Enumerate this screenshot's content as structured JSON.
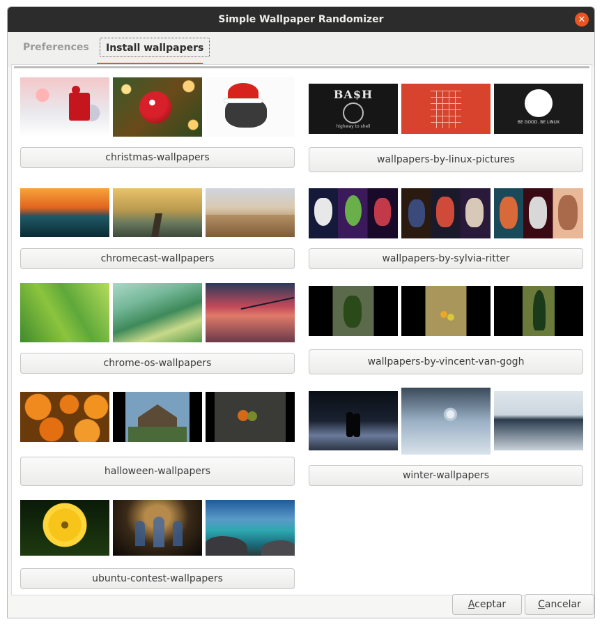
{
  "window": {
    "title": "Simple Wallpaper Randomizer"
  },
  "tabs": [
    {
      "label": "Preferences"
    },
    {
      "label": "Install wallpapers"
    }
  ],
  "packs": [
    {
      "label": "christmas-wallpapers"
    },
    {
      "label": "wallpapers-by-linux-pictures"
    },
    {
      "label": "chromecast-wallpapers"
    },
    {
      "label": "wallpapers-by-sylvia-ritter"
    },
    {
      "label": "chrome-os-wallpapers"
    },
    {
      "label": "wallpapers-by-vincent-van-gogh"
    },
    {
      "label": "halloween-wallpapers"
    },
    {
      "label": "winter-wallpapers"
    },
    {
      "label": "ubuntu-contest-wallpapers"
    }
  ],
  "linux_pictures": {
    "bash_text": "BA$H",
    "bash_tagline": "highway to shell",
    "good_text": "BE GOOD. BE LINUX"
  },
  "footer": {
    "accept_label": "Aceptar",
    "cancel_label": "Cancelar",
    "accept_mnemonic": "A",
    "cancel_mnemonic": "C"
  }
}
